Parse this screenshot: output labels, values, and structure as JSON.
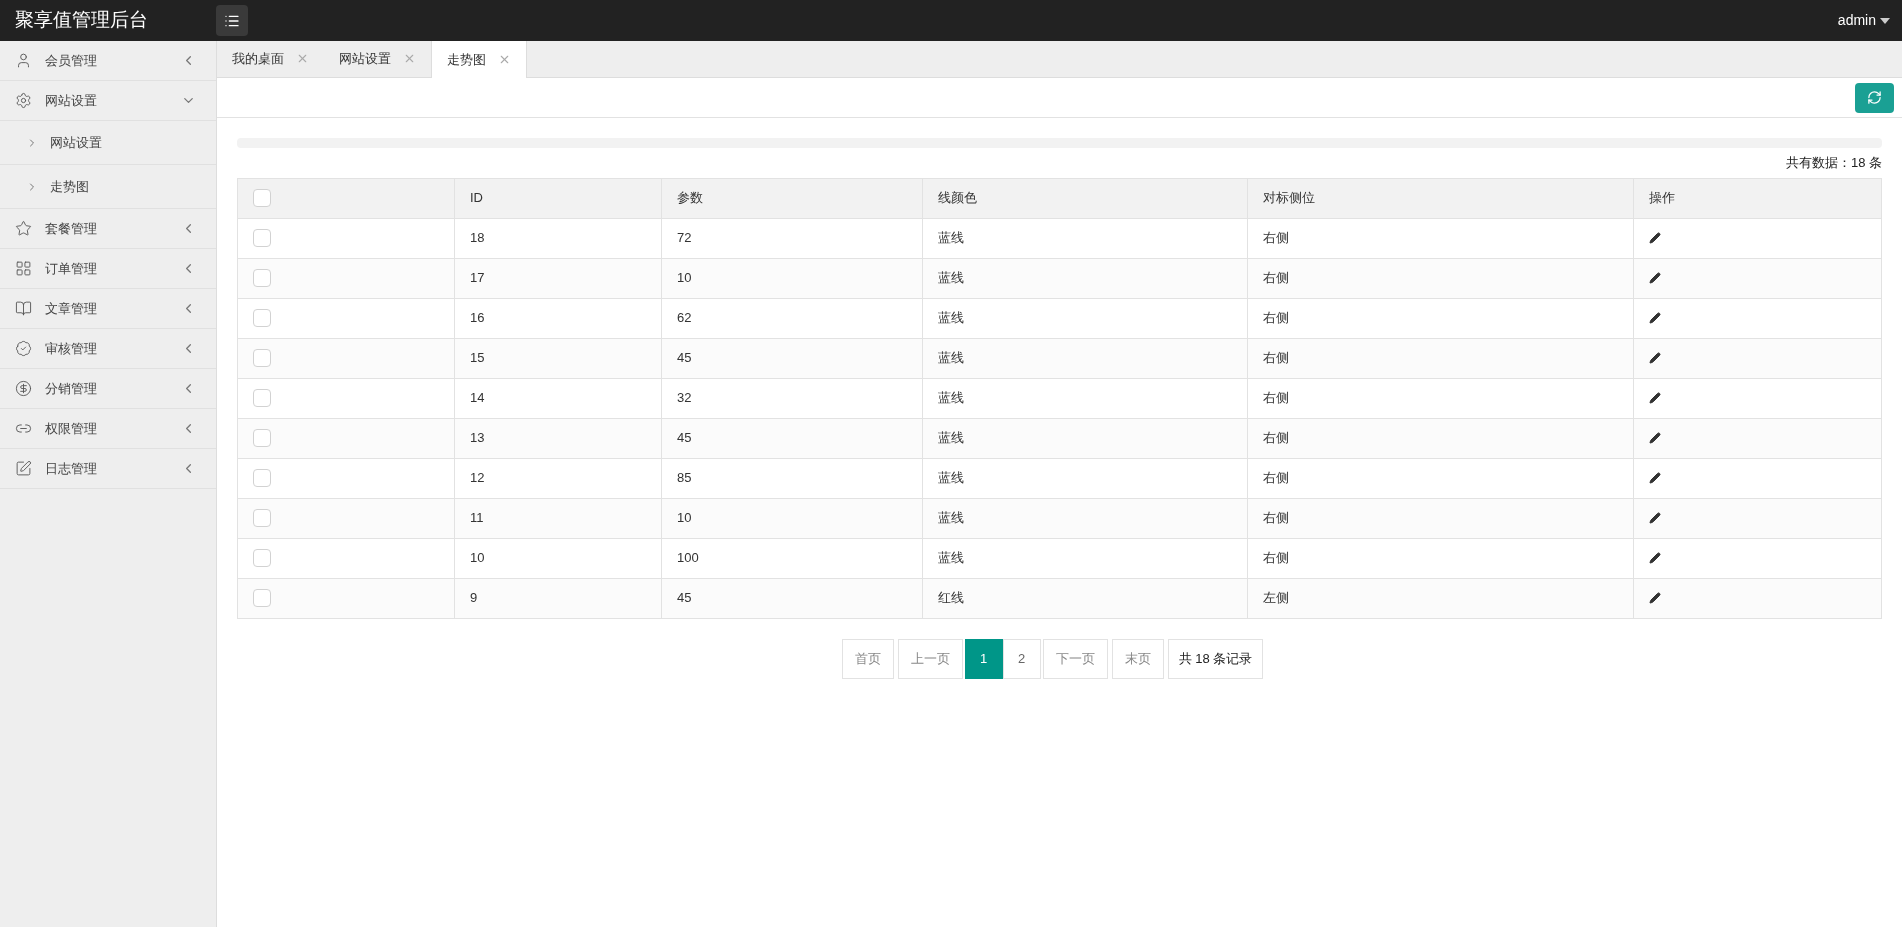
{
  "header": {
    "title": "聚享值管理后台",
    "user": "admin"
  },
  "sidebar": {
    "items": [
      {
        "label": "会员管理",
        "expanded": false
      },
      {
        "label": "网站设置",
        "expanded": true,
        "children": [
          {
            "label": "网站设置"
          },
          {
            "label": "走势图"
          }
        ]
      },
      {
        "label": "套餐管理",
        "expanded": false
      },
      {
        "label": "订单管理",
        "expanded": false
      },
      {
        "label": "文章管理",
        "expanded": false
      },
      {
        "label": "审核管理",
        "expanded": false
      },
      {
        "label": "分销管理",
        "expanded": false
      },
      {
        "label": "权限管理",
        "expanded": false
      },
      {
        "label": "日志管理",
        "expanded": false
      }
    ]
  },
  "tabs": [
    {
      "label": "我的桌面",
      "selected": false
    },
    {
      "label": "网站设置",
      "selected": false
    },
    {
      "label": "走势图",
      "selected": true
    }
  ],
  "summary": "共有数据：18 条",
  "table": {
    "header_checked": false,
    "columns": [
      "ID",
      "参数",
      "线颜色",
      "对标侧位",
      "操作"
    ],
    "rows": [
      {
        "checked": false,
        "cells": [
          "18",
          "72",
          "蓝线",
          "右侧"
        ]
      },
      {
        "checked": false,
        "cells": [
          "17",
          "10",
          "蓝线",
          "右侧"
        ]
      },
      {
        "checked": false,
        "cells": [
          "16",
          "62",
          "蓝线",
          "右侧"
        ]
      },
      {
        "checked": false,
        "cells": [
          "15",
          "45",
          "蓝线",
          "右侧"
        ]
      },
      {
        "checked": false,
        "cells": [
          "14",
          "32",
          "蓝线",
          "右侧"
        ]
      },
      {
        "checked": false,
        "cells": [
          "13",
          "45",
          "蓝线",
          "右侧"
        ]
      },
      {
        "checked": false,
        "cells": [
          "12",
          "85",
          "蓝线",
          "右侧"
        ]
      },
      {
        "checked": false,
        "cells": [
          "11",
          "10",
          "蓝线",
          "右侧"
        ]
      },
      {
        "checked": false,
        "cells": [
          "10",
          "100",
          "蓝线",
          "右侧"
        ]
      },
      {
        "checked": false,
        "cells": [
          "9",
          "45",
          "红线",
          "左侧"
        ]
      }
    ]
  },
  "pagination": [
    {
      "kind": "link",
      "label": "首页"
    },
    {
      "kind": "link",
      "label": "上一页"
    },
    {
      "kind": "page",
      "label": "1",
      "selected": true
    },
    {
      "kind": "page",
      "label": "2",
      "selected": false
    },
    {
      "kind": "link",
      "label": "下一页"
    },
    {
      "kind": "link",
      "label": "末页"
    },
    {
      "kind": "count",
      "label": "共 18 条记录"
    }
  ]
}
